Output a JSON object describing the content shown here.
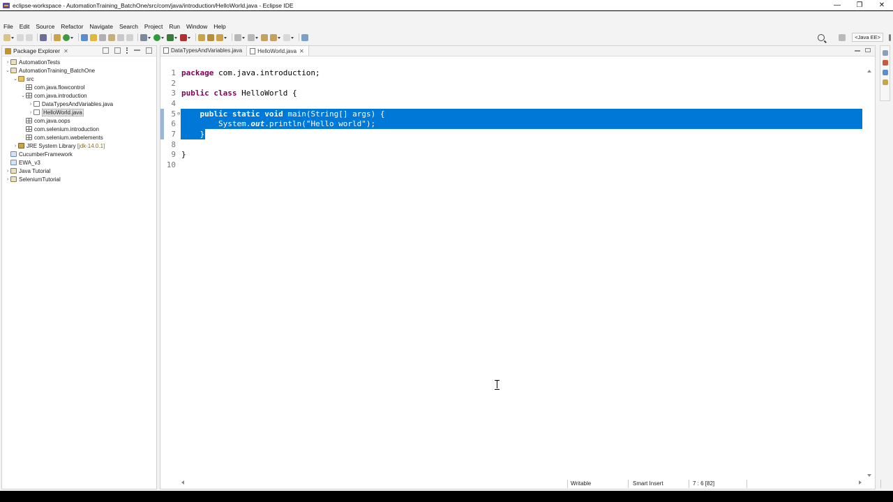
{
  "window": {
    "title": "eclipse-workspace - AutomationTraining_BatchOne/src/com/java/introduction/HelloWorld.java - Eclipse IDE",
    "controls": {
      "minimize": "—",
      "maximize": "❐",
      "close": "✕"
    }
  },
  "menu": [
    "File",
    "Edit",
    "Source",
    "Refactor",
    "Navigate",
    "Search",
    "Project",
    "Run",
    "Window",
    "Help"
  ],
  "toolbar": {
    "perspective_label": "<Java EE>"
  },
  "package_explorer": {
    "title": "Package Explorer",
    "tree": [
      {
        "label": "AutomationTests",
        "twisty": "›",
        "icon": "project",
        "indent": 0
      },
      {
        "label": "AutomationTraining_BatchOne",
        "twisty": "⌄",
        "icon": "project",
        "indent": 0
      },
      {
        "label": "src",
        "twisty": "⌄",
        "icon": "folder",
        "indent": 1
      },
      {
        "label": "com.java.flowcontrol",
        "twisty": "",
        "icon": "package",
        "indent": 2
      },
      {
        "label": "com.java.introduction",
        "twisty": "⌄",
        "icon": "package",
        "indent": 2
      },
      {
        "label": "DataTypesAndVariables.java",
        "twisty": "›",
        "icon": "java",
        "indent": 3
      },
      {
        "label": "HelloWorld.java",
        "twisty": "›",
        "icon": "java",
        "indent": 3,
        "selected": true
      },
      {
        "label": "com.java.oops",
        "twisty": "",
        "icon": "package",
        "indent": 2
      },
      {
        "label": "com.selenium.introduction",
        "twisty": "",
        "icon": "package",
        "indent": 2
      },
      {
        "label": "com.selenium.webelements",
        "twisty": "",
        "icon": "package",
        "indent": 2
      },
      {
        "label": "JRE System Library",
        "suffix": "[jdk-14.0.1]",
        "twisty": "›",
        "icon": "lib",
        "indent": 1
      },
      {
        "label": "CucumberFramework",
        "twisty": "",
        "icon": "proj2",
        "indent": 0
      },
      {
        "label": "EWA_v3",
        "twisty": "",
        "icon": "proj2",
        "indent": 0
      },
      {
        "label": "Java Tutorial",
        "twisty": "›",
        "icon": "project",
        "indent": 0
      },
      {
        "label": "SeleniumTutorial",
        "twisty": "›",
        "icon": "project",
        "indent": 0
      }
    ]
  },
  "editor": {
    "tabs": [
      {
        "label": "DataTypesAndVariables.java",
        "active": false
      },
      {
        "label": "HelloWorld.java",
        "active": true,
        "close": "✕"
      }
    ],
    "lines": [
      {
        "n": "1",
        "tokens": [
          [
            "kw",
            "package"
          ],
          [
            "t",
            " com.java.introduction;"
          ]
        ]
      },
      {
        "n": "2",
        "tokens": []
      },
      {
        "n": "3",
        "tokens": [
          [
            "kw",
            "public"
          ],
          [
            "t",
            " "
          ],
          [
            "kw",
            "class"
          ],
          [
            "t",
            " HelloWorld {"
          ]
        ]
      },
      {
        "n": "4",
        "tokens": []
      },
      {
        "n": "5",
        "fold": "⊖",
        "tokens": [
          [
            "t",
            "    "
          ],
          [
            "kw",
            "public"
          ],
          [
            "t",
            " "
          ],
          [
            "kw",
            "static"
          ],
          [
            "t",
            " "
          ],
          [
            "kw",
            "void"
          ],
          [
            "t",
            " main(String[] args) {"
          ]
        ]
      },
      {
        "n": "6",
        "tokens": [
          [
            "t",
            "        System."
          ],
          [
            "fld",
            "out"
          ],
          [
            "t",
            ".println("
          ],
          [
            "str",
            "\"Hello world\""
          ],
          [
            "t",
            ");"
          ]
        ]
      },
      {
        "n": "7",
        "tokens": [
          [
            "t",
            "    }"
          ]
        ]
      },
      {
        "n": "8",
        "tokens": []
      },
      {
        "n": "9",
        "tokens": [
          [
            "t",
            "}"
          ]
        ]
      },
      {
        "n": "10",
        "tokens": []
      }
    ]
  },
  "status": {
    "writable": "Writable",
    "insert_mode": "Smart Insert",
    "position": "7 : 6 [82]"
  }
}
